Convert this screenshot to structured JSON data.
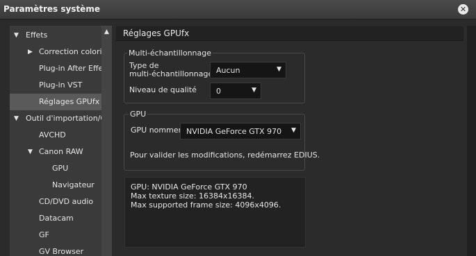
{
  "window": {
    "title": "Paramètres système"
  },
  "tree": {
    "items": [
      {
        "label": "Effets",
        "expanded": true
      },
      {
        "label": "Correction colorimétrique",
        "collapsed": true
      },
      {
        "label": "Plug-in After Effects"
      },
      {
        "label": "Plug-in VST"
      },
      {
        "label": "Réglages GPUfx",
        "selected": true
      },
      {
        "label": "Outil d'importation/Outil d'exportation",
        "expanded": true
      },
      {
        "label": "AVCHD"
      },
      {
        "label": "Canon RAW",
        "expanded": true
      },
      {
        "label": "GPU"
      },
      {
        "label": "Navigateur"
      },
      {
        "label": "CD/DVD audio"
      },
      {
        "label": "Datacam"
      },
      {
        "label": "GF"
      },
      {
        "label": "GV Browser"
      }
    ]
  },
  "panel": {
    "title": "Réglages GPUfx",
    "multisampling": {
      "group_label": "Multi-échantillonnage",
      "type_label_line1": "Type de",
      "type_label_line2": "multi-échantillonnage",
      "type_value": "Aucun",
      "quality_label": "Niveau de qualité",
      "quality_value": "0"
    },
    "gpu": {
      "group_label": "GPU",
      "name_label": "GPU nomment",
      "name_value": "NVIDIA GeForce GTX 970",
      "notice": "Pour valider les modifications, redémarrez EDIUS."
    },
    "info": {
      "line1": "GPU: NVIDIA GeForce GTX 970",
      "line2": "Max texture size: 16384x16384.",
      "line3": "Max supported frame size: 4096x4096."
    }
  }
}
